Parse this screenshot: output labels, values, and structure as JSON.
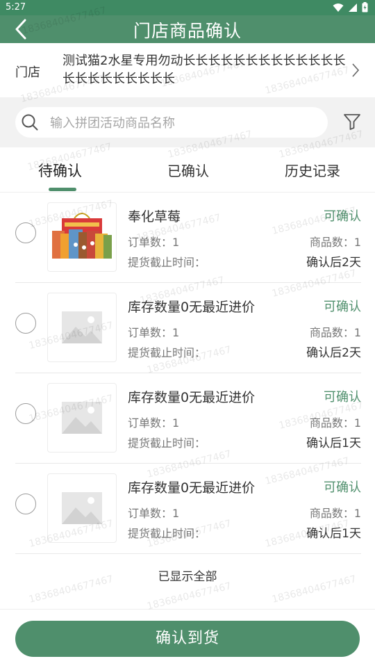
{
  "status_bar": {
    "time": "5:27"
  },
  "navbar": {
    "title": "门店商品确认"
  },
  "store": {
    "label": "门店",
    "name": "测试猫2水星专用勿动长长长长长长长长长长长长长长长长长长长长长长"
  },
  "search": {
    "placeholder": "输入拼团活动商品名称",
    "value": ""
  },
  "tabs": [
    {
      "label": "待确认",
      "active": true
    },
    {
      "label": "已确认",
      "active": false
    },
    {
      "label": "历史记录",
      "active": false
    }
  ],
  "items": [
    {
      "name": "奉化草莓",
      "status": "可确认",
      "orders_label": "订单数：1",
      "goods_label": "商品数：1",
      "deadline_label": "提货截止时间：",
      "deadline_value": "确认后2天",
      "image": "product-photo"
    },
    {
      "name": "库存数量0无最近进价",
      "status": "可确认",
      "orders_label": "订单数：1",
      "goods_label": "商品数：1",
      "deadline_label": "提货截止时间：",
      "deadline_value": "确认后2天",
      "image": "placeholder"
    },
    {
      "name": "库存数量0无最近进价",
      "status": "可确认",
      "orders_label": "订单数：1",
      "goods_label": "商品数：1",
      "deadline_label": "提货截止时间：",
      "deadline_value": "确认后1天",
      "image": "placeholder"
    },
    {
      "name": "库存数量0无最近进价",
      "status": "可确认",
      "orders_label": "订单数：1",
      "goods_label": "商品数：1",
      "deadline_label": "提货截止时间：",
      "deadline_value": "确认后1天",
      "image": "placeholder"
    }
  ],
  "list_footer": "已显示全部",
  "confirm_button": "确认到货",
  "watermark": "18368404677467",
  "colors": {
    "primary": "#4f8f6c",
    "status_bar": "#3f8a63",
    "search_bg": "#f2f2f2"
  },
  "icons": [
    "back-arrow-icon",
    "wifi-icon",
    "signal-icon",
    "battery-icon",
    "chevron-right-icon",
    "search-icon",
    "filter-icon",
    "image-placeholder-icon"
  ]
}
